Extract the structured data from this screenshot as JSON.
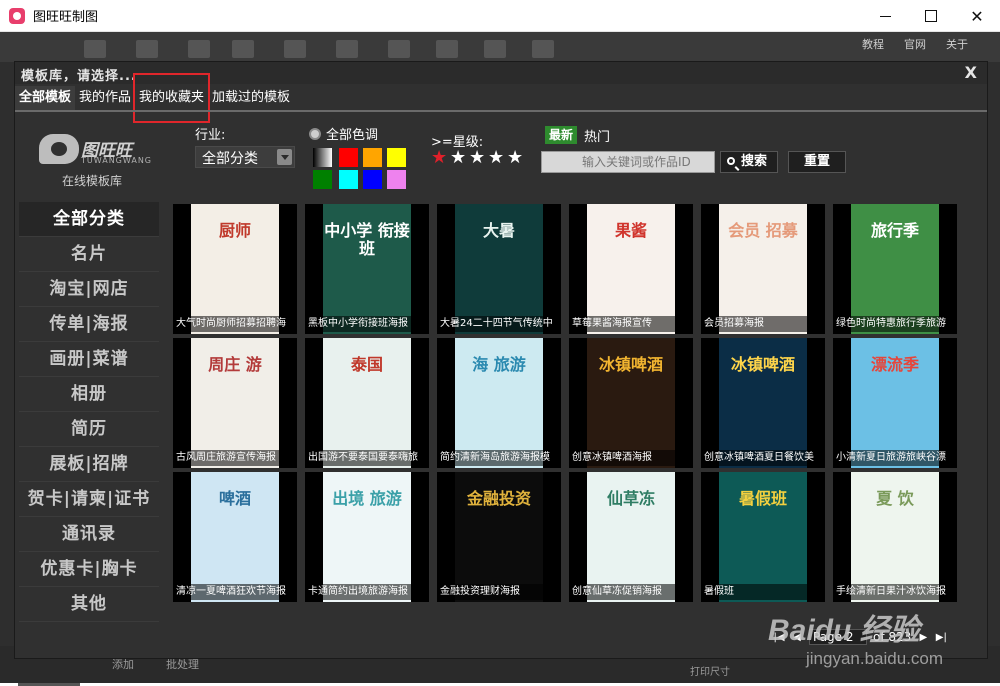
{
  "window": {
    "title": "图旺旺制图"
  },
  "app": {
    "links": [
      "教程",
      "官网",
      "关于"
    ],
    "bottom": {
      "add": "添加",
      "batch": "批处理",
      "print_size": "打印尺寸"
    }
  },
  "dialog": {
    "title": "模板库，请选择...",
    "close": "X",
    "tabs": [
      "全部模板",
      "我的作品",
      "我的收藏夹",
      "加载过的模板"
    ],
    "active_tab": "全部模板",
    "highlighted_tab": "我的收藏夹"
  },
  "logo": {
    "name": "图旺旺",
    "pinyin": "TUWANGWANG",
    "caption": "在线模板库"
  },
  "categories": [
    "全部分类",
    "名片",
    "淘宝|网店",
    "传单|海报",
    "画册|菜谱",
    "相册",
    "简历",
    "展板|招牌",
    "贺卡|请柬|证书",
    "通讯录",
    "优惠卡|胸卡",
    "其他"
  ],
  "filters": {
    "industry_label": "行业:",
    "industry_value": "全部分类",
    "color_label": "全部色调",
    "colors": [
      "#ff0000",
      "#ffa500",
      "#ffff00",
      "#008000",
      "#00ffff",
      "#0000ff",
      "#ee82ee"
    ],
    "star_label": ">=星级:",
    "stars_selected": 1,
    "stars_total": 5,
    "sort_new": "最新",
    "sort_hot": "热门",
    "search_placeholder": "输入关键词或作品ID",
    "search_btn": "搜索",
    "reset_btn": "重置"
  },
  "templates": [
    {
      "caption": "大气时尚厨师招募招聘海",
      "poster_text": "厨师",
      "bg": "#f3eee6",
      "fg": "#c0392b"
    },
    {
      "caption": "黑板中小学衔接班海报",
      "poster_text": "中小学 衔接班",
      "bg": "#1e5a4a",
      "fg": "#ffffff"
    },
    {
      "caption": "大暑24二十四节气传统中",
      "poster_text": "大暑",
      "bg": "#0f3b3a",
      "fg": "#e8f3ef"
    },
    {
      "caption": "草莓果酱海报宣传",
      "poster_text": "果酱",
      "bg": "#f7f1ec",
      "fg": "#d0342c"
    },
    {
      "caption": "会员招募海报",
      "poster_text": "会员 招募",
      "bg": "#f5f0ea",
      "fg": "#e59a7a"
    },
    {
      "caption": "绿色时尚特惠旅行季旅游",
      "poster_text": "旅行季",
      "bg": "#3f8f45",
      "fg": "#ffffff"
    },
    {
      "caption": "古风周庄旅游宣传海报",
      "poster_text": "周庄 游",
      "bg": "#f1eee8",
      "fg": "#b33a3a"
    },
    {
      "caption": "出国游不要泰国要泰嗨旅",
      "poster_text": "泰国",
      "bg": "#e8f1ee",
      "fg": "#c0392b"
    },
    {
      "caption": "简约清新海岛旅游海报模",
      "poster_text": "海 旅游",
      "bg": "#cdeaf1",
      "fg": "#2b8ab0"
    },
    {
      "caption": "创意冰镇啤酒海报",
      "poster_text": "冰镇啤酒",
      "bg": "#2a1a10",
      "fg": "#f2b530"
    },
    {
      "caption": "创意冰镇啤酒夏日餐饮美",
      "poster_text": "冰镇啤酒",
      "bg": "#0b2d46",
      "fg": "#ffd54a"
    },
    {
      "caption": "小清新夏日旅游旅峡谷漂",
      "poster_text": "漂流季",
      "bg": "#6cc0e5",
      "fg": "#e6453a"
    },
    {
      "caption": "清凉一夏啤酒狂欢节海报",
      "poster_text": "啤酒",
      "bg": "#cfe6f3",
      "fg": "#2a6f9c"
    },
    {
      "caption": "卡通简约出境旅游海报",
      "poster_text": "出境 旅游",
      "bg": "#eef6f7",
      "fg": "#3aa0a8"
    },
    {
      "caption": "金融投资理财海报",
      "poster_text": "金融投资",
      "bg": "#0c0c0c",
      "fg": "#e0b23c"
    },
    {
      "caption": "创意仙草冻促销海报",
      "poster_text": "仙草冻",
      "bg": "#e9f3f1",
      "fg": "#2f7d64"
    },
    {
      "caption": "暑假班",
      "poster_text": "暑假班",
      "bg": "#0d5a56",
      "fg": "#f4d03f"
    },
    {
      "caption": "手绘清新日果汁冰饮海报",
      "poster_text": "夏 饮",
      "bg": "#eef5ee",
      "fg": "#7a9a5a"
    }
  ],
  "pager": {
    "label": "Page",
    "current": "2",
    "of_label": "of 823"
  },
  "watermark": {
    "brand": "Baidu 经验",
    "url": "jingyan.baidu.com"
  }
}
